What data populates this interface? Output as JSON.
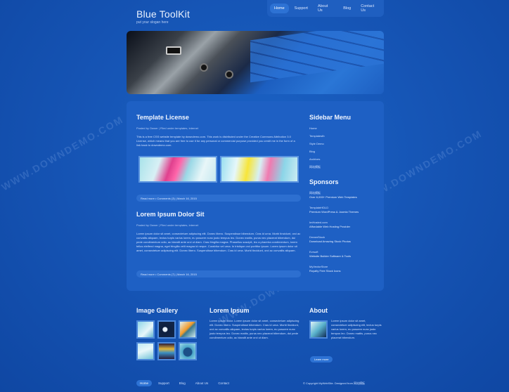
{
  "site": {
    "title": "Blue ToolKit",
    "slogan": "put your slogan here"
  },
  "nav": [
    "Home",
    "Support",
    "About Us",
    "Blog",
    "Contact Us"
  ],
  "posts": [
    {
      "title": "Template License",
      "meta": "Posted by Owner | Filed under templates, internet",
      "body": "This is a free CSS website template by downdemo.com. This work is distributed under the Creative Commons Attribution 3.0 License, which means that you are free to use it for any personal or commercial purpose provided you credit me in the form of a link back to downdemo.com.",
      "footer": "Read more  •  Comments (3)  |  March 16, 2015"
    },
    {
      "title": "Lorem Ipsum Dolor Sit",
      "meta": "Posted by Owner | Filed under templates, internet",
      "body": "Lorem ipsum dolor sit amet, consectetuer adipiscing elit. Donec libero. Suspendisse bibendum. Cras id urna. Morbi tincidunt, orci ac convallis aliquam, lectus turpis varius lorem, eu posuere nunc justo tempus leo. Donec mattis, purus nec placerat bibendum, dui pede condimentum odio, ac blandit ante orci ut diam. Cras fringilla magna. Phasellus suscipit, leo a pharetra condimentum, lorem tellus eleifend magna, eget fringilla velit magna id neque. Curabitur vel urna. In tristique orci porttitor ipsum. Lorem ipsum dolor sit amet, consectetuer adipiscing elit. Donec libero. Suspendisse bibendum. Cras id urna. Morbi tincidunt, orci ac convallis aliquam.",
      "footer": "Read more  •  Comments (7)  |  March 16, 2015"
    }
  ],
  "sidebar": {
    "menu_title": "Sidebar Menu",
    "menu_items": [
      "Home",
      "Templatesfb",
      "Style Demo",
      "Blog",
      "Archives",
      "网站模板"
    ],
    "sponsors_title": "Sponsors",
    "sponsors": [
      {
        "name": "网站模板",
        "desc": "Over 6,000+ Premium Web Templates"
      },
      {
        "name": "TemplateHDLD",
        "desc": "Premium WordPress & Joomla Themes"
      },
      {
        "name": "ImHosted.com",
        "desc": "Affordable Web Hosting Provider"
      },
      {
        "name": "DreamStock",
        "desc": "Download Amazing Stock Photos"
      },
      {
        "name": "Evrsoft",
        "desc": "Website Builder Software & Tools"
      },
      {
        "name": "MyVectorStore",
        "desc": "Royalty Free Stock Icons"
      }
    ]
  },
  "bottom": {
    "gallery_title": "Image Gallery",
    "lorem_title": "Lorem Ipsum",
    "lorem_text": "Lorem ipsum dolor. Lorem ipsum dolor sit amet, consectetuer adipiscing elit. Donec libero. Suspendisse bibendum. Cras id urna. Morbi tincidunt, orci ac convallis aliquam, lectus turpis varius lorem, eu posuere nunc justo tempus leo. Donec mattis, purus nec placerat bibendum, dui pede condimentum odio, ac blandit ante orci ut diam.",
    "about_title": "About",
    "about_text": "Lorem ipsum dolor sit amet, consectetuer adipiscing elit, lectus turpis varius lorem, eu posuere nunc justo tempus leo. Donec mattis, purus nec placerat bibendum.",
    "learn_more": "Learn more"
  },
  "footer": {
    "nav": [
      "Home",
      "Support",
      "Blog",
      "About Us",
      "Contact"
    ],
    "copyright": "© Copyright MyWebSite. Designed from 网站模板"
  },
  "watermark": "WWW.DOWNDEMO.COM",
  "colors": {
    "background": "#1456b8",
    "panel": "#1e60c4",
    "accent": "#2d72d4"
  }
}
